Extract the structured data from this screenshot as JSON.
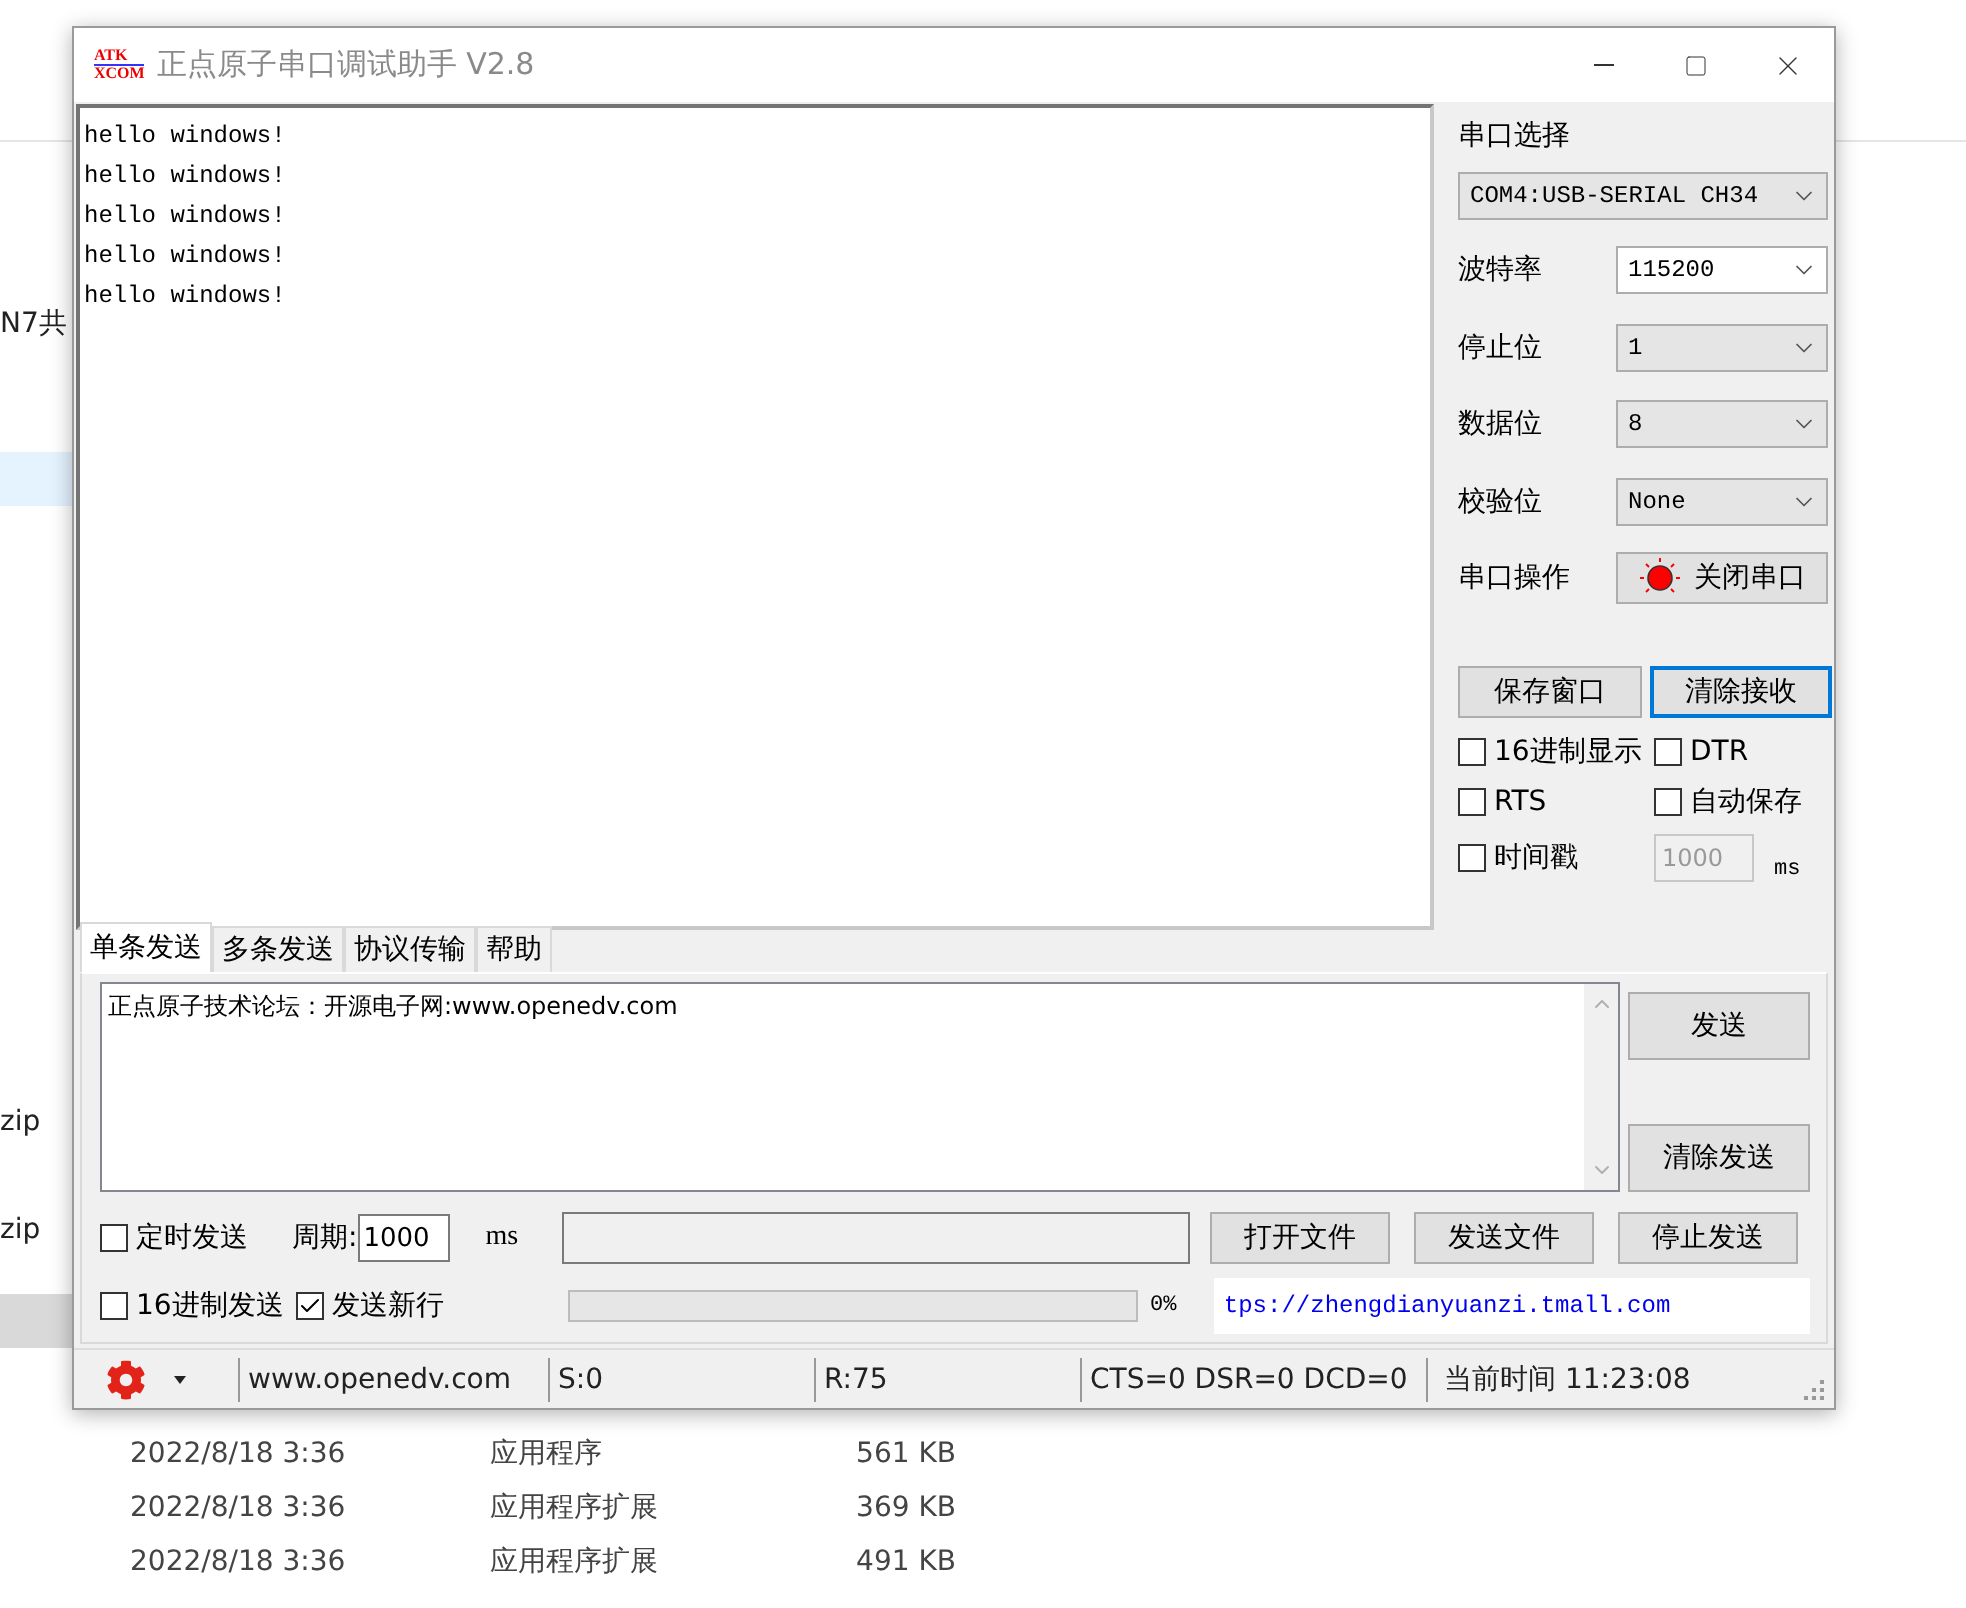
{
  "explorer": {
    "side_items": [
      "N7共",
      "zip",
      "zip"
    ],
    "rows": [
      {
        "date": "2022/8/18 3:36",
        "type": "应用程序",
        "size": "561 KB"
      },
      {
        "date": "2022/8/18 3:36",
        "type": "应用程序扩展",
        "size": "369 KB"
      },
      {
        "date": "2022/8/18 3:36",
        "type": "应用程序扩展",
        "size": "491 KB"
      }
    ]
  },
  "window": {
    "title": "正点原子串口调试助手 V2.8",
    "logo": [
      "ATK",
      "XCOM"
    ]
  },
  "receive": {
    "lines": [
      "hello windows!",
      "hello windows!",
      "hello windows!",
      "hello windows!",
      "hello windows!"
    ]
  },
  "settings": {
    "port_label": "串口选择",
    "port_value": "COM4:USB-SERIAL CH34",
    "fields": [
      {
        "label": "波特率",
        "value": "115200",
        "kind": "editable"
      },
      {
        "label": "停止位",
        "value": "1",
        "kind": "select"
      },
      {
        "label": "数据位",
        "value": "8",
        "kind": "select"
      },
      {
        "label": "校验位",
        "value": "None",
        "kind": "select"
      }
    ],
    "operation": {
      "label": "串口操作",
      "button": "关闭串口",
      "open": true
    },
    "buttons": [
      {
        "label": "保存窗口",
        "focused": false
      },
      {
        "label": "清除接收",
        "focused": true
      }
    ],
    "checkboxes": [
      {
        "label": "16进制显示",
        "checked": false
      },
      {
        "label": "DTR",
        "checked": false
      },
      {
        "label": "RTS",
        "checked": false
      },
      {
        "label": "自动保存",
        "checked": false
      },
      {
        "label": "时间戳",
        "checked": false
      }
    ],
    "timestamp_interval": "1000",
    "timestamp_unit": "ms"
  },
  "tabs": [
    {
      "label": "单条发送",
      "selected": true
    },
    {
      "label": "多条发送",
      "selected": false
    },
    {
      "label": "协议传输",
      "selected": false
    },
    {
      "label": "帮助",
      "selected": false
    }
  ],
  "send": {
    "text": "正点原子技术论坛：开源电子网:www.openedv.com",
    "buttons": [
      "发送",
      "清除发送"
    ],
    "timed": {
      "label": "定时发送",
      "checked": false
    },
    "period_label": "周期:",
    "period_value": "1000",
    "period_unit": "ms",
    "file_buttons": [
      "打开文件",
      "发送文件",
      "停止发送"
    ],
    "hex_send": {
      "label": "16进制发送",
      "checked": false
    },
    "newline": {
      "label": "发送新行",
      "checked": true
    },
    "progress": {
      "level": 0,
      "reading": "0%"
    },
    "link": "tps://zhengdianyuanzi.tmall.com"
  },
  "status_bar": {
    "site": "www.openedv.com",
    "sent": "S:0",
    "received": "R:75",
    "lines": "CTS=0 DSR=0 DCD=0",
    "time": "当前时间 11:23:08"
  }
}
